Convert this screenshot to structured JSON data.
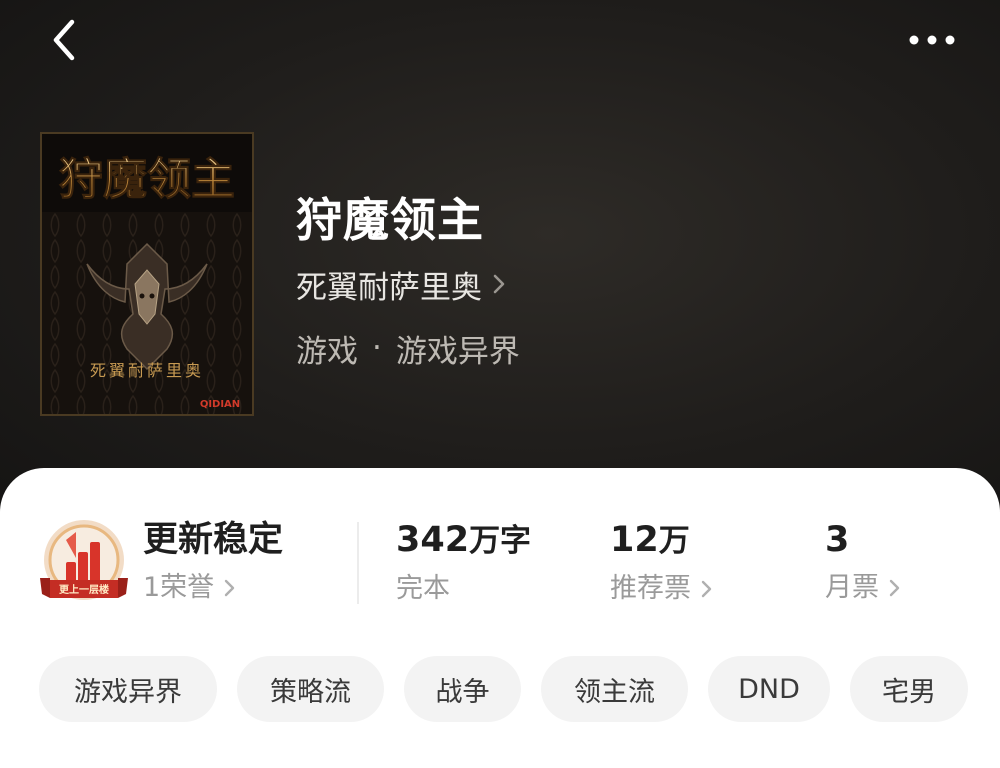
{
  "header": {
    "back_icon": "chevron-left-icon",
    "more_icon": "more-dots-icon"
  },
  "book": {
    "title": "狩魔领主",
    "author": "死翼耐萨里奥",
    "category": "游戏",
    "separator": "·",
    "subcategory": "游戏异界",
    "cover": {
      "title_art": "狩魔领主",
      "author_art": "死翼耐萨里奥",
      "publisher_mark": "QIDIAN"
    }
  },
  "stats": {
    "honor": {
      "title": "更新稳定",
      "sub": "1荣誉",
      "badge_text": "更上一层楼"
    },
    "words": {
      "value": "342",
      "unit": "万字",
      "sub": "完本"
    },
    "recommend": {
      "value": "12",
      "unit": "万",
      "sub": "推荐票"
    },
    "monthly": {
      "value": "3",
      "sub": "月票"
    }
  },
  "tags": [
    "游戏异界",
    "策略流",
    "战争",
    "领主流",
    "DND",
    "宅男"
  ],
  "colors": {
    "hero_bg": "#1f1d1b",
    "card_bg": "#ffffff",
    "tag_bg": "#f3f3f3",
    "badge_red": "#d8342a",
    "badge_gold": "#e8b880"
  }
}
